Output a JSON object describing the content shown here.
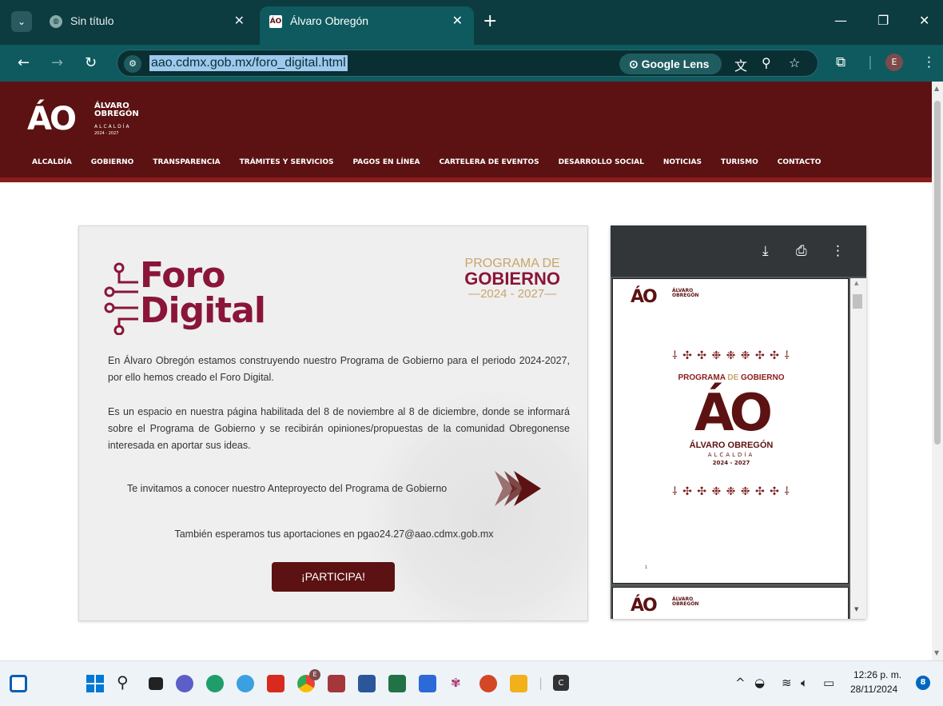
{
  "browser": {
    "tabs": [
      {
        "title": "Sin título",
        "favicon": "globe-icon"
      },
      {
        "title": "Álvaro Obregón",
        "favicon_text": "ÁO",
        "active": true
      }
    ],
    "url": "aao.cdmx.gob.mx/foro_digital.html",
    "lens_label": "Google Lens",
    "profile_initial": "E"
  },
  "site": {
    "logo_mark": "ÁO",
    "logo_name_1": "ÁLVARO",
    "logo_name_2": "OBREGÓN",
    "logo_sub": "ALCALDÍA",
    "logo_years": "2024 - 2027",
    "nav": [
      "ALCALDÍA",
      "GOBIERNO",
      "TRANSPARENCIA",
      "TRÁMITES Y SERVICIOS",
      "PAGOS EN LÍNEA",
      "CARTELERA DE EVENTOS",
      "DESARROLLO SOCIAL",
      "NOTICIAS",
      "TURISMO",
      "CONTACTO"
    ]
  },
  "card": {
    "foro_1": "Foro",
    "foro_2": "Digital",
    "pg_1": "PROGRAMA DE",
    "pg_2": "GOBIERNO",
    "pg_3": "—2024 - 2027—",
    "para_1": "En Álvaro Obregón estamos construyendo nuestro Programa de Gobierno para el periodo 2024-2027, por ello hemos creado el Foro Digital.",
    "para_2": "Es un espacio en nuestra página habilitada del 8 de noviembre al 8 de diciembre, donde se informará sobre el Programa de Gobierno y se recibirán opiniones/propuestas de la comunidad Obregonense interesada en aportar sus ideas.",
    "invite": "Te invitamos a conocer nuestro Anteproyecto del Programa de Gobierno",
    "email_line": "También esperamos tus aportaciones en pgao24.27@aao.cdmx.gob.mx",
    "button": "¡PARTICIPA!"
  },
  "pdf": {
    "mini_mark": "ÁO",
    "mini_name_1": "ÁLVARO",
    "mini_name_2": "OBREGÓN",
    "ornament": "⸸ ✣ ✣ ❉ ❉ ❉ ✣ ✣ ⸸",
    "program_1": "PROGRAMA",
    "program_2": " DE ",
    "program_3": "GOBIERNO",
    "big_mark": "ÁO",
    "name": "ÁLVARO OBREGÓN",
    "alcaldia": "ALCALDÍA",
    "years": "2024 - 2027",
    "page_num": "1"
  },
  "taskbar": {
    "time": "12:26 p. m.",
    "date": "28/11/2024",
    "notifications": "8",
    "pinned_badge": "E",
    "app_c": "C"
  }
}
